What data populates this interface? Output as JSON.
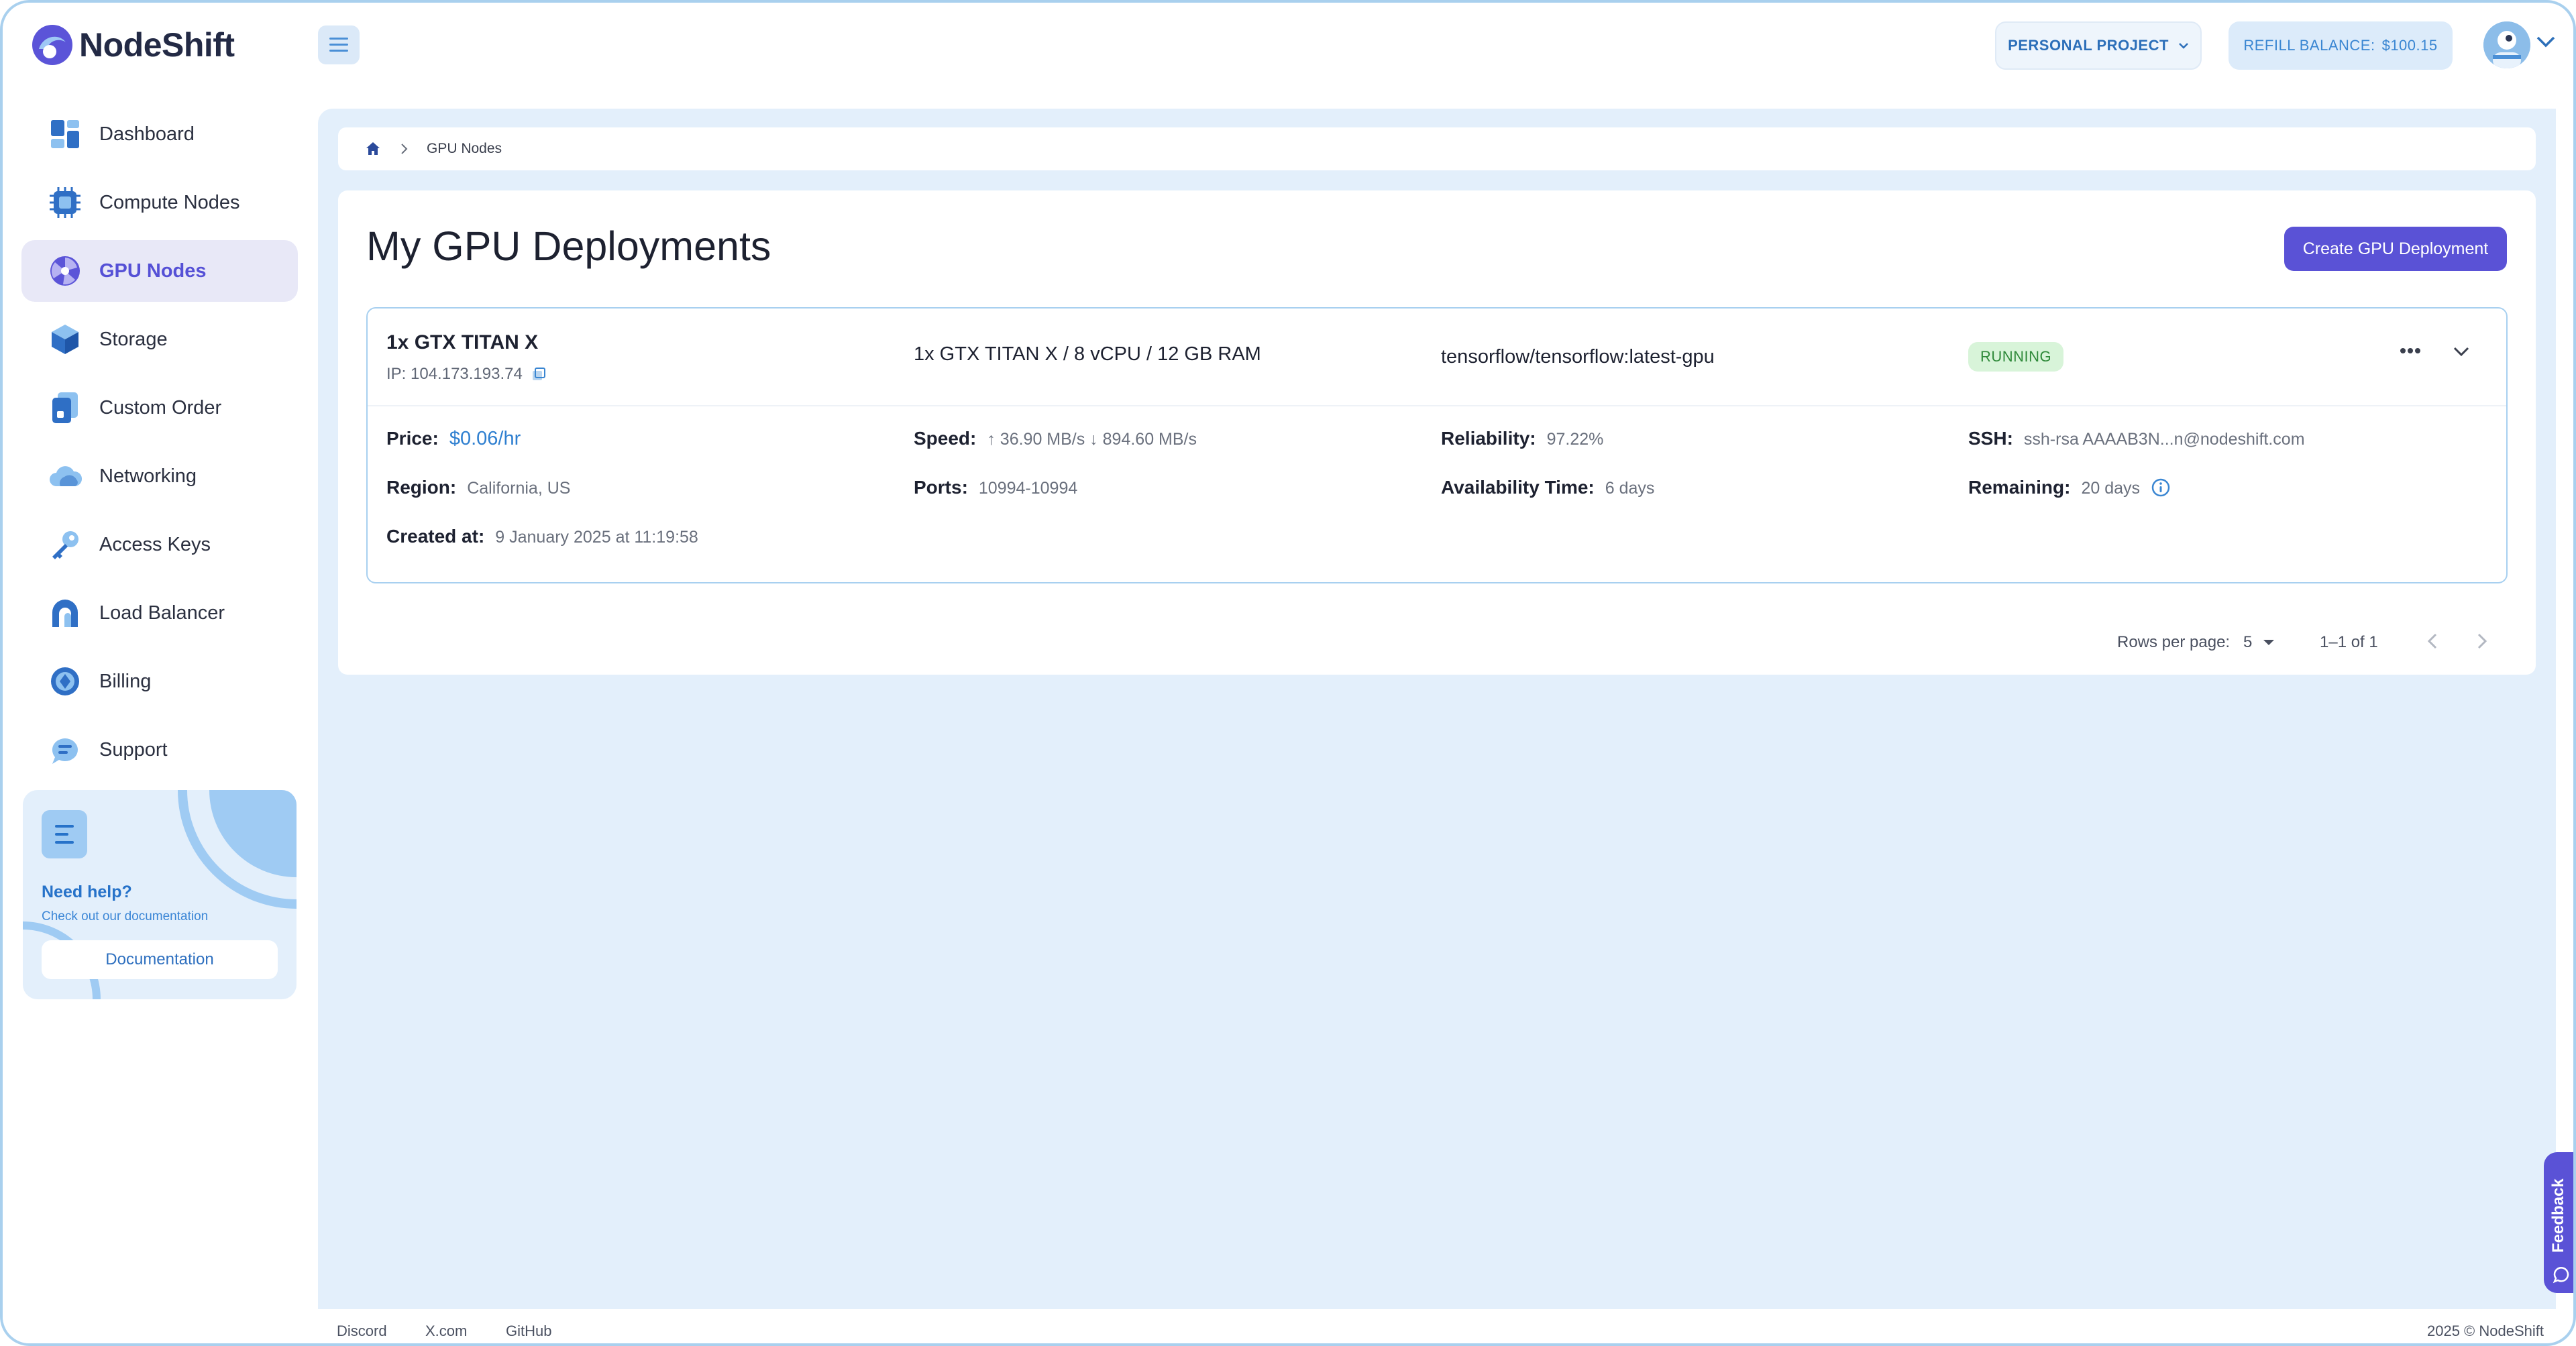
{
  "brand": {
    "name": "NodeShift"
  },
  "sidebar": {
    "items": [
      {
        "label": "Dashboard",
        "icon": "dashboard-icon",
        "active": false
      },
      {
        "label": "Compute Nodes",
        "icon": "cpu-chip-icon",
        "active": false
      },
      {
        "label": "GPU Nodes",
        "icon": "gpu-icon",
        "active": true
      },
      {
        "label": "Storage",
        "icon": "storage-cube-icon",
        "active": false
      },
      {
        "label": "Custom Order",
        "icon": "custom-order-icon",
        "active": false
      },
      {
        "label": "Networking",
        "icon": "cloud-icon",
        "active": false
      },
      {
        "label": "Access Keys",
        "icon": "key-icon",
        "active": false
      },
      {
        "label": "Load Balancer",
        "icon": "load-balancer-icon",
        "active": false
      },
      {
        "label": "Billing",
        "icon": "billing-icon",
        "active": false
      },
      {
        "label": "Support",
        "icon": "support-chat-icon",
        "active": false
      }
    ],
    "help": {
      "title": "Need help?",
      "subtitle": "Check out our documentation",
      "button": "Documentation"
    }
  },
  "topbar": {
    "project": "PERSONAL PROJECT",
    "refill_label": "REFILL BALANCE:",
    "refill_amount": "$100.15"
  },
  "breadcrumb": {
    "current": "GPU Nodes"
  },
  "page": {
    "title": "My GPU Deployments",
    "create_button": "Create GPU Deployment"
  },
  "deployment": {
    "name": "1x GTX TITAN X",
    "ip": "IP: 104.173.193.74",
    "spec": "1x GTX TITAN X / 8 vCPU / 12 GB RAM",
    "image": "tensorflow/tensorflow:latest-gpu",
    "status": "RUNNING",
    "fields": {
      "price_label": "Price:",
      "price": "$0.06/hr",
      "speed_label": "Speed:",
      "speed": "↑ 36.90 MB/s ↓ 894.60 MB/s",
      "reliability_label": "Reliability:",
      "reliability": "97.22%",
      "ssh_label": "SSH:",
      "ssh": "ssh-rsa AAAAB3N...n@nodeshift.com",
      "region_label": "Region:",
      "region": "California, US",
      "ports_label": "Ports:",
      "ports": "10994-10994",
      "availability_label": "Availability Time:",
      "availability": "6 days",
      "remaining_label": "Remaining:",
      "remaining": "20 days",
      "created_label": "Created at:",
      "created": "9 January 2025 at 11:19:58"
    }
  },
  "pagination": {
    "rows_label": "Rows per page:",
    "rows_value": "5",
    "range": "1–1 of 1"
  },
  "footer": {
    "links": [
      "Discord",
      "X.com",
      "GitHub"
    ],
    "copyright": "2025 © NodeShift"
  },
  "feedback": {
    "label": "Feedback"
  },
  "colors": {
    "accent": "#5a52d6",
    "main_bg": "#e3effb",
    "status_bg": "#d8f4d9",
    "status_text": "#2f8a3a",
    "link_blue": "#2e7fd0"
  }
}
